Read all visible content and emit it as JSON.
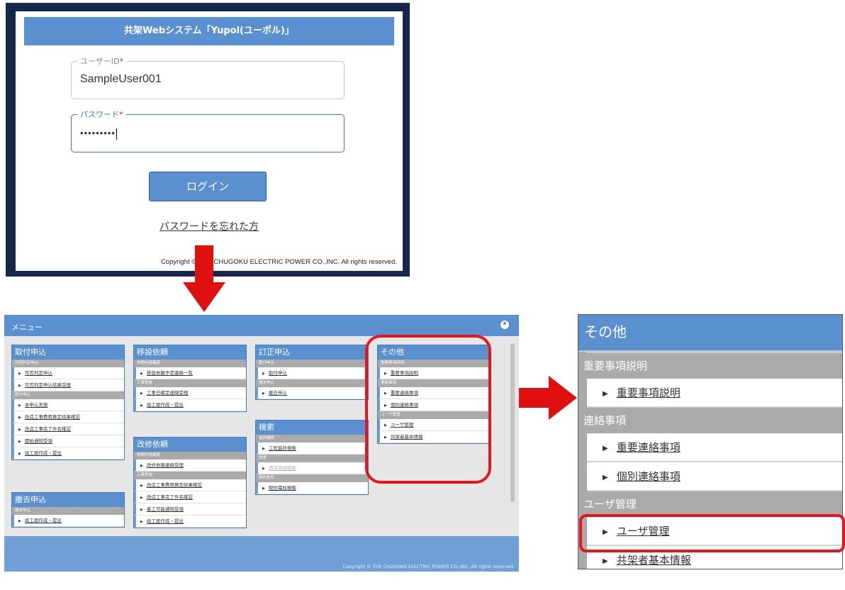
{
  "login": {
    "header_title": "共架Webシステム「Yupol(ユーポル)」",
    "userid_label": "ユーザーID",
    "userid_value": "SampleUser001",
    "password_label": "パスワード",
    "password_value": "•••••••••",
    "required_mark": "*",
    "login_button": "ログイン",
    "forgot_link": "パスワードを忘れた方",
    "copyright": "Copyright © THE CHUGOKU ELECTRIC POWER CO.,INC. All rights reserved."
  },
  "menu": {
    "title": "メニュー",
    "copyright": "Copyright © THE CHUGOKU ELECTRIC POWER CO.,INC. All rights reserved.",
    "cards": {
      "toritsuke": {
        "title": "取付申込",
        "sections": [
          {
            "label": "可否判定申込",
            "items": [
              "可否判定申込",
              "可否判定申込結果受理"
            ]
          },
          {
            "label": "取付申込",
            "items": [
              "本申込実施",
              "改造工事費用算定結果確認",
              "改造工事完了件名確認",
              "開始通知受領",
              "竣工届作成・提出"
            ]
          }
        ]
      },
      "tekkyo": {
        "title": "撤去申込",
        "sections": [
          {
            "label": "撤去申込",
            "items": [
              "竣工届作成・提出"
            ]
          }
        ]
      },
      "isetsu": {
        "title": "移設依頼",
        "sections": [
          {
            "label": "依頼内容確認",
            "items": [
              "移設依頼予定連絡一覧"
            ]
          },
          {
            "label": "工事実施",
            "items": [
              "工事日確定連絡受理",
              "竣工届作成・提出"
            ]
          }
        ]
      },
      "kaishu": {
        "title": "改修依頼",
        "sections": [
          {
            "label": "依頼内容確認",
            "items": [
              "改修依頼連絡受理"
            ]
          },
          {
            "label": "工事実施",
            "items": [
              "改造工事費用算定結果確認",
              "改造工事完了件名確認",
              "着工可能通知受領",
              "竣工届作成・提出"
            ]
          }
        ]
      },
      "teisei": {
        "title": "訂正申込",
        "sections": [
          {
            "label": "取付申込",
            "items": [
              "取付申込"
            ]
          },
          {
            "label": "撤去申込",
            "items": [
              "撤去申込"
            ]
          }
        ]
      },
      "kensaku": {
        "title": "検索",
        "sections": [
          {
            "label": "進捗確認",
            "items": [
              "工程進捗検索"
            ]
          },
          {
            "label": "請求",
            "items": [
              "請求明細検索"
            ]
          },
          {
            "label": "契約条件",
            "items": [
              "契約電柱検索"
            ]
          }
        ]
      },
      "sonota": {
        "title": "その他",
        "sections": [
          {
            "label": "重要事項説明",
            "items": [
              "重要事項説明"
            ]
          },
          {
            "label": "連絡事項",
            "items": [
              "重要連絡事項",
              "個別連絡事項"
            ]
          },
          {
            "label": "ユーザ管理",
            "items": [
              "ユーザ管理",
              "共架者基本情報"
            ]
          }
        ]
      }
    }
  },
  "zoom": {
    "title": "その他",
    "sections": [
      {
        "label": "重要事項説明",
        "items": [
          "重要事項説明"
        ]
      },
      {
        "label": "連絡事項",
        "items": [
          "重要連絡事項",
          "個別連絡事項"
        ]
      },
      {
        "label": "ユーザ管理",
        "items": [
          "ユーザ管理",
          "共架者基本情報"
        ]
      }
    ]
  },
  "colors": {
    "header_blue": "#5a90cf",
    "dark_navy": "#16264d",
    "section_gray": "#aaaaaa",
    "highlight_red": "#e8141b"
  }
}
